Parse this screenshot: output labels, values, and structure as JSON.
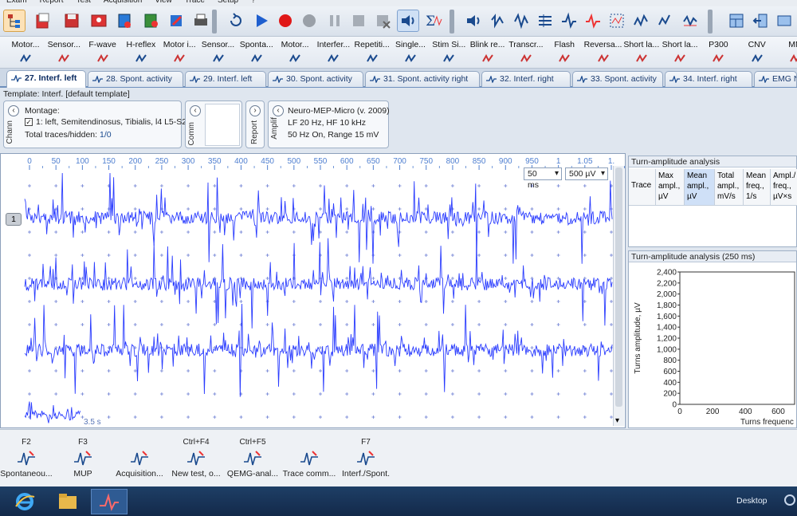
{
  "menu": [
    "Exam",
    "Report",
    "Test",
    "Acquisition",
    "View",
    "Trace",
    "Setup",
    "?"
  ],
  "tests": [
    "Motor...",
    "Sensor...",
    "F-wave",
    "H-reflex",
    "Motor i...",
    "Sensor...",
    "Sponta...",
    "Motor...",
    "Interfer...",
    "Repetiti...",
    "Single...",
    "Stim Si...",
    "Blink re...",
    "Transcr...",
    "Flash",
    "Reversa...",
    "Short la...",
    "Short la...",
    "P300",
    "CNV",
    "MM"
  ],
  "tabs": [
    "27. Interf. left",
    "28. Spont. activity",
    "29. Interf. left",
    "30. Spont. activity",
    "31. Spont. activity right",
    "32. Interf. right",
    "33. Spont. activity",
    "34. Interf. right",
    "EMG N"
  ],
  "template": "Template: Interf. [default template]",
  "montage": {
    "vlabel": "Chann",
    "title": "Montage:",
    "item": "1: left, Semitendinosus, Tibialis, l4 L5-S2",
    "total_label": "Total traces/hidden:",
    "total_value": "1/0"
  },
  "comm_label": "Comm",
  "report_label": "Report",
  "amplif": {
    "vlabel": "Amplif",
    "device": "Neuro-MEP-Micro (v. 2009)",
    "line1": "LF  20 Hz, HF  10 kHz",
    "line2": "50 Hz  On, Range  15 mV"
  },
  "time_ticks": [
    "0",
    "50",
    "100",
    "150",
    "200",
    "250",
    "300",
    "350",
    "400",
    "450",
    "500",
    "550",
    "600",
    "650",
    "700",
    "750",
    "800",
    "850",
    "900",
    "950",
    "1",
    "1.05",
    "1."
  ],
  "sweep_dropdown": "50 ms",
  "sens_dropdown": "500 µV",
  "trace_number": "1",
  "time_marker": "3.5 s",
  "turn_table": {
    "title": "Turn-amplitude analysis",
    "headers": [
      [
        "Trace"
      ],
      [
        "Max",
        "ampl.,",
        "µV"
      ],
      [
        "Mean",
        "ampl.,",
        "µV"
      ],
      [
        "Total",
        "ampl.,",
        "mV/s"
      ],
      [
        "Mean",
        "freq.,",
        "1/s"
      ],
      [
        "Ampl./",
        "freq.,",
        "µV×s"
      ]
    ]
  },
  "turn_chart_title": "Turn-amplitude analysis (250 ms)",
  "chart_data": {
    "type": "scatter",
    "title": "Turn-amplitude analysis (250 ms)",
    "ylabel": "Turns amplitude, µV",
    "xlabel": "Turns frequenc",
    "yticks": [
      "2,400",
      "2,200",
      "2,000",
      "1,800",
      "1,600",
      "1,400",
      "1,200",
      "1,000",
      "800",
      "600",
      "400",
      "200",
      "0"
    ],
    "xticks": [
      "0",
      "200",
      "400",
      "600"
    ],
    "ylim": [
      0,
      2400
    ],
    "xlim": [
      0,
      700
    ],
    "series": []
  },
  "function_keys": [
    {
      "key": "F2",
      "label": "Spontaneou..."
    },
    {
      "key": "F3",
      "label": "MUP"
    },
    {
      "key": "",
      "label": "Acquisition..."
    },
    {
      "key": "Ctrl+F4",
      "label": "New test, o..."
    },
    {
      "key": "Ctrl+F5",
      "label": "QEMG-anal..."
    },
    {
      "key": "",
      "label": "Trace comm..."
    },
    {
      "key": "F7",
      "label": "Interf./Spont."
    }
  ],
  "taskbar": {
    "desktop": "Desktop"
  },
  "colors": {
    "trace": "#2a3cff",
    "accent": "#1a5cc8",
    "grid": "#4f7fd0"
  }
}
